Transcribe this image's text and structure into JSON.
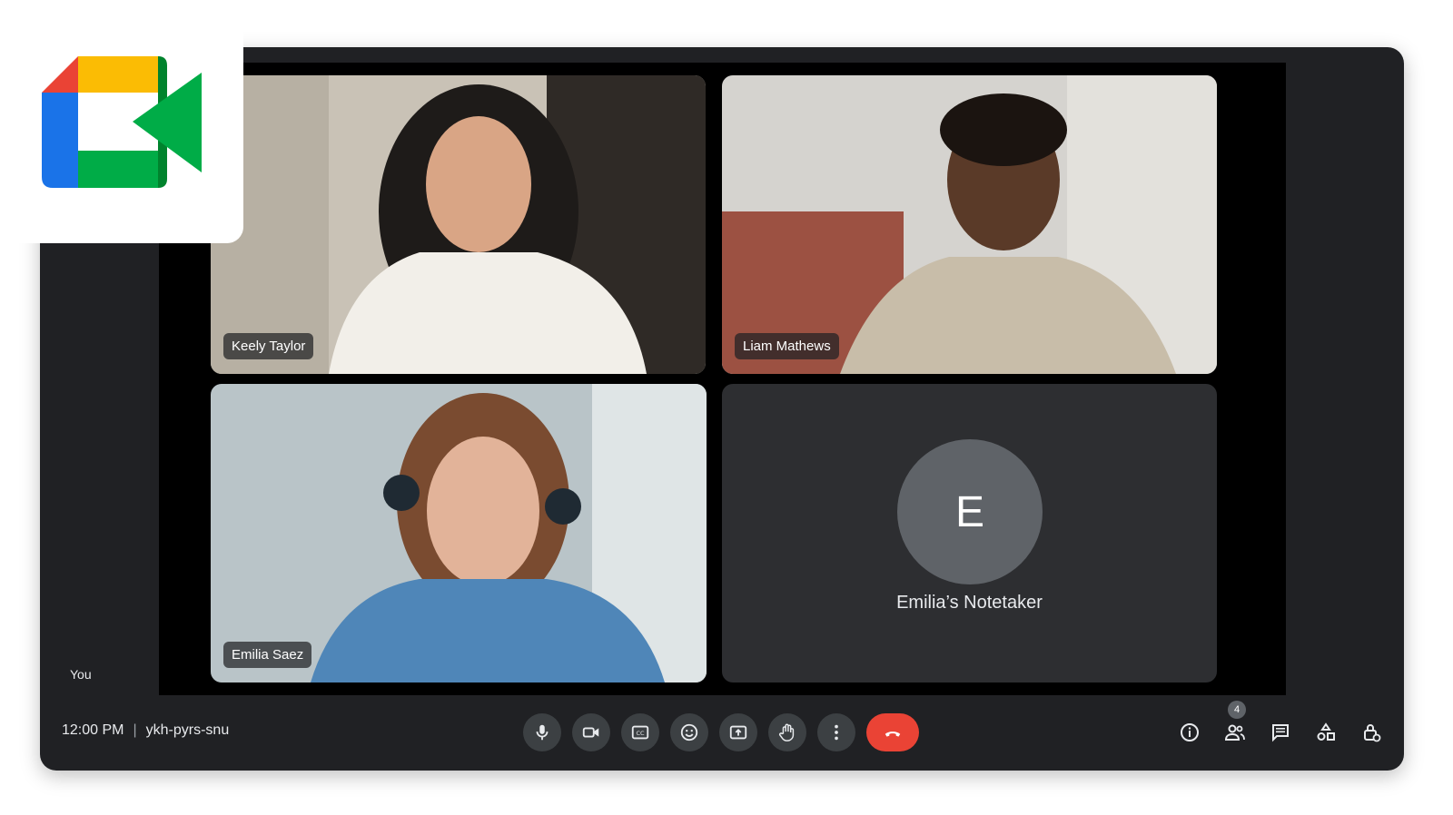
{
  "app": {
    "name": "Google Meet"
  },
  "participants": [
    {
      "name": "Keely Taylor"
    },
    {
      "name": "Liam Mathews"
    },
    {
      "name": "Emilia Saez"
    },
    {
      "name": "Emilia’s Notetaker",
      "initial": "E"
    }
  ],
  "self_label": "You",
  "meeting": {
    "time": "12:00 PM",
    "separator": "|",
    "code": "ykh-pyrs-snu"
  },
  "controls": [
    {
      "icon": "microphone-icon"
    },
    {
      "icon": "camera-icon"
    },
    {
      "icon": "captions-icon"
    },
    {
      "icon": "emoji-icon"
    },
    {
      "icon": "present-screen-icon"
    },
    {
      "icon": "raise-hand-icon"
    },
    {
      "icon": "more-options-icon"
    },
    {
      "icon": "end-call-icon"
    }
  ],
  "side_actions": [
    {
      "icon": "info-icon"
    },
    {
      "icon": "people-icon",
      "badge": "4"
    },
    {
      "icon": "chat-icon"
    },
    {
      "icon": "activities-icon"
    },
    {
      "icon": "host-controls-icon"
    }
  ],
  "colors": {
    "background": "#202124",
    "button": "#3c4043",
    "end_call": "#ea4335",
    "logo_red": "#ea4335",
    "logo_yellow": "#fbbc04",
    "logo_green": "#00ac47",
    "logo_blue": "#1a73e8"
  }
}
